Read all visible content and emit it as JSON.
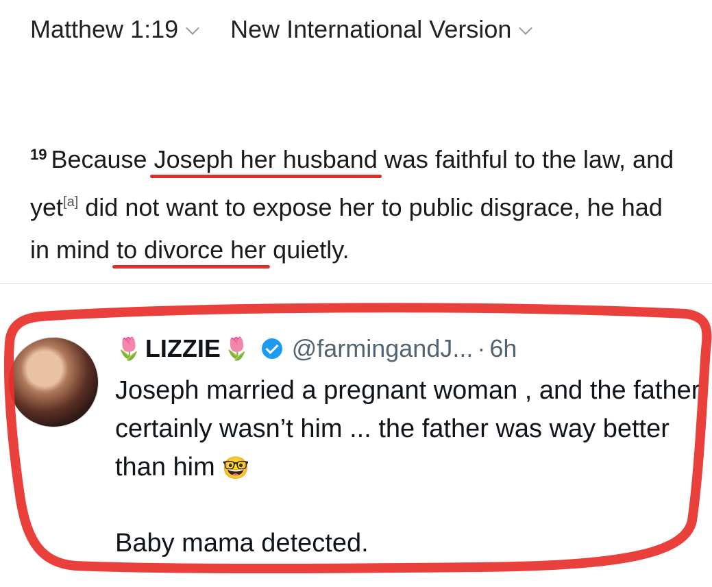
{
  "verse": {
    "reference": "Matthew 1:19",
    "version": "New International Version",
    "number": "19",
    "segments": {
      "s1": "Because ",
      "u1": "Joseph her husband",
      "s2": " was faithful to the law, and yet",
      "footnote": "[a]",
      "s3": " did not want to expose her to public disgrace, he had in mind ",
      "u2": "to divorce her",
      "s4": " quietly."
    },
    "underline_color": "#e0302c"
  },
  "tweet": {
    "emoji_left": "🌷",
    "display_name": "LIZZIE",
    "emoji_right": "🌷",
    "handle": "@farmingandJ...",
    "separator": "·",
    "time": "6h",
    "lines": {
      "p1": "Joseph married a pregnant woman , and the father certainly wasn’t him ... the father was way better than him",
      "p1_emoji": "🤓",
      "p2": "Baby mama detected."
    },
    "verified_color": "#1d9bf0",
    "icons": [
      "tulip-icon",
      "verified-badge-icon",
      "nerd-face-icon"
    ]
  },
  "annotation": {
    "marker_color": "#e8302a"
  }
}
